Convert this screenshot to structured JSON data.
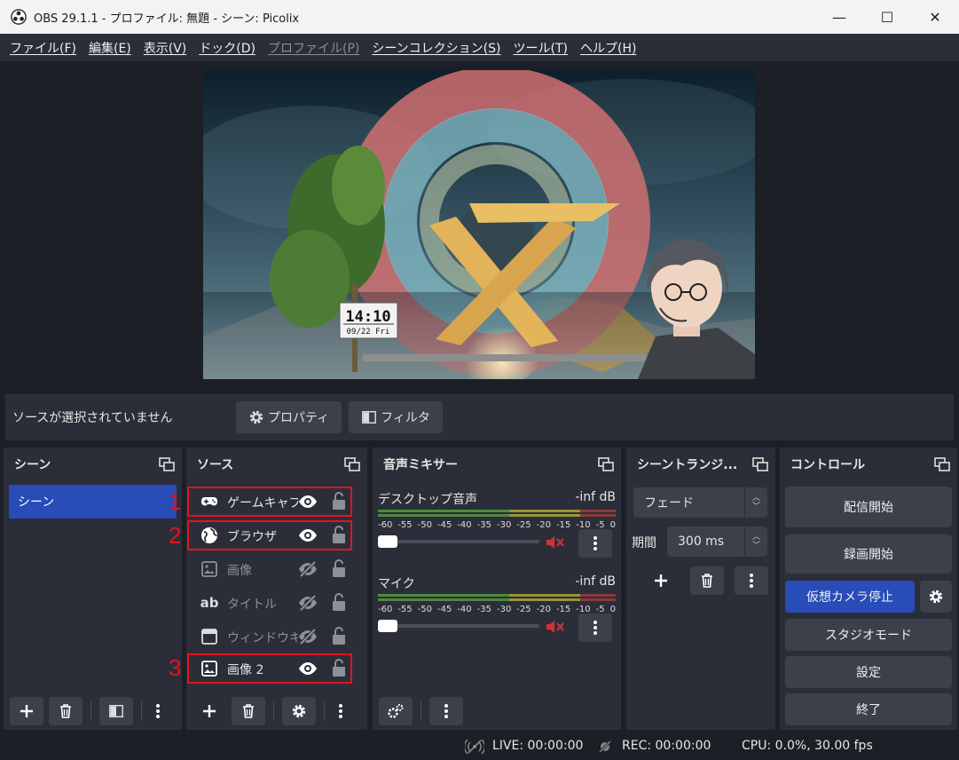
{
  "window": {
    "title": "OBS 29.1.1 - プロファイル: 無題 - シーン: Picolix",
    "minimize": "—",
    "maximize": "☐",
    "close": "✕"
  },
  "menu": [
    {
      "label": "ファイル(F)",
      "enabled": true
    },
    {
      "label": "編集(E)",
      "enabled": true
    },
    {
      "label": "表示(V)",
      "enabled": true
    },
    {
      "label": "ドック(D)",
      "enabled": true
    },
    {
      "label": "プロファイル(P)",
      "enabled": false
    },
    {
      "label": "シーンコレクション(S)",
      "enabled": true
    },
    {
      "label": "ツール(T)",
      "enabled": true
    },
    {
      "label": "ヘルプ(H)",
      "enabled": true
    }
  ],
  "preview": {
    "clock_time": "14:10",
    "clock_date": "09/22 Fri"
  },
  "source_bar": {
    "no_selection": "ソースが選択されていません",
    "properties": "プロパティ",
    "filters": "フィルタ"
  },
  "scenes": {
    "title": "シーン",
    "items": [
      "シーン"
    ]
  },
  "sources": {
    "title": "ソース",
    "items": [
      {
        "name": "ゲームキャプチャ",
        "icon": "gamepad-icon",
        "visible": true,
        "marker": "1"
      },
      {
        "name": "ブラウザ",
        "icon": "globe-icon",
        "visible": true,
        "marker": "2"
      },
      {
        "name": "画像",
        "icon": "image-icon",
        "visible": false,
        "marker": ""
      },
      {
        "name": "タイトル",
        "icon": "text-icon",
        "visible": false,
        "marker": ""
      },
      {
        "name": "ウィンドウキャプチャ",
        "icon": "window-icon",
        "visible": false,
        "marker": ""
      },
      {
        "name": "画像 2",
        "icon": "image-icon",
        "visible": true,
        "marker": "3"
      }
    ]
  },
  "mixer": {
    "title": "音声ミキサー",
    "ticks": [
      "-60",
      "-55",
      "-50",
      "-45",
      "-40",
      "-35",
      "-30",
      "-25",
      "-20",
      "-15",
      "-10",
      "-5",
      "0"
    ],
    "channels": [
      {
        "name": "デスクトップ音声",
        "level": "-inf dB"
      },
      {
        "name": "マイク",
        "level": "-inf dB"
      }
    ]
  },
  "transitions": {
    "title": "シーントランジ...",
    "selected": "フェード",
    "duration_label": "期間",
    "duration_value": "300 ms"
  },
  "controls": {
    "title": "コントロール",
    "start_stream": "配信開始",
    "start_record": "録画開始",
    "virtual_cam": "仮想カメラ停止",
    "studio_mode": "スタジオモード",
    "settings": "設定",
    "exit": "終了"
  },
  "status": {
    "live": "LIVE: 00:00:00",
    "rec": "REC: 00:00:00",
    "cpu": "CPU: 0.0%, 30.00 fps"
  },
  "colors": {
    "accent": "#284cb8",
    "panel": "#2b2e38",
    "background": "#1d1f26",
    "button": "#3c404b",
    "highlight_box": "#e0141f",
    "mute": "#d0303a"
  }
}
